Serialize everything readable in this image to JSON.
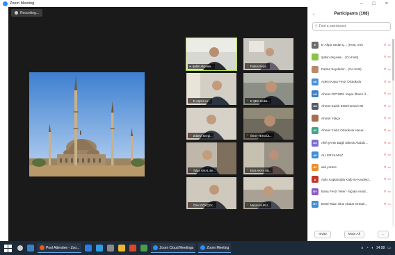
{
  "window": {
    "title": "Zoom Meeting",
    "controls": [
      "–",
      "□",
      "×"
    ]
  },
  "recording": {
    "label": "Recording..."
  },
  "participants_panel": {
    "header": "Participants (108)",
    "search_placeholder": "Find a participant",
    "participants": [
      {
        "initials": "E",
        "name": "E-Afşar Sedat Ç... (Host, me)",
        "color": "#6b6b6b"
      },
      {
        "initials": "",
        "name": "Şahin Akçaala... (Co-host)",
        "color": "#8bc34a"
      },
      {
        "initials": "",
        "name": "Fatma Seydemir... (Co-host)",
        "color": "#b98a6e"
      },
      {
        "initials": "AK",
        "name": "Adem Kaya Fevzi Ortaokulu",
        "color": "#4a8fd8"
      },
      {
        "initials": "AÖ",
        "name": "Ahmet ÖZTÜRK Yaşar İlhami Ü...",
        "color": "#3d7fc4"
      },
      {
        "initials": "AS",
        "name": "Ahmet Sadık EGE/Horsa İHO",
        "color": "#555a66"
      },
      {
        "initials": "",
        "name": "Ahmet Yükçe",
        "color": "#a66d4f"
      },
      {
        "initials": "AY",
        "name": "Ahmet Yıldız Ortaokulu Hacer ...",
        "color": "#3fa58b"
      },
      {
        "initials": "AŞ",
        "name": "Akif ŞAHE Bağlı Elbeck Abdulz...",
        "color": "#7a6fcf"
      },
      {
        "initials": "AE",
        "name": "ALİ ERYILMAZ",
        "color": "#3d8fd6"
      },
      {
        "initials": "AY",
        "name": "asli yorüce",
        "color": "#e89030"
      },
      {
        "initials": "A",
        "name": "Aylin Kaplanoğlu Kalb ve Kardeşl...",
        "color": "#c0392b"
      },
      {
        "initials": "BY",
        "name": "Barış Fevzi Yeter - Işçiala Anad...",
        "color": "#8e5bbf"
      },
      {
        "initials": "BT",
        "name": "Betül Tolan Ulus Abalar Ortaok...",
        "color": "#3d8fd6"
      }
    ],
    "footer": {
      "invite": "Invite",
      "mute_all": "Mute All",
      "more": "..."
    }
  },
  "video_tiles": [
    {
      "label": "Şahin Akçaala..."
    },
    {
      "label": "Fatma Seyd..."
    },
    {
      "label": "E-AŞAH Lu..."
    },
    {
      "label": "E-ŞEK Sedat..."
    },
    {
      "label": "Zübeyi Sezgi..."
    },
    {
      "label": "Ömer TEKGÜL..."
    },
    {
      "label": "Tolga ONAL Be..."
    },
    {
      "label": "Esra AKAY ulu..."
    },
    {
      "label": "Özer GÖKÇEK..."
    },
    {
      "label": "Nazan KURU..."
    }
  ],
  "taskbar": {
    "apps": [
      {
        "label": "Pool Attendee - Zoo...",
        "color": "#e85a2a"
      },
      {
        "label": "Zoom Cloud Meetings",
        "color": "#2d8cff"
      },
      {
        "label": "Zoom Meeting",
        "color": "#2d8cff"
      }
    ],
    "clock": "14:58"
  }
}
